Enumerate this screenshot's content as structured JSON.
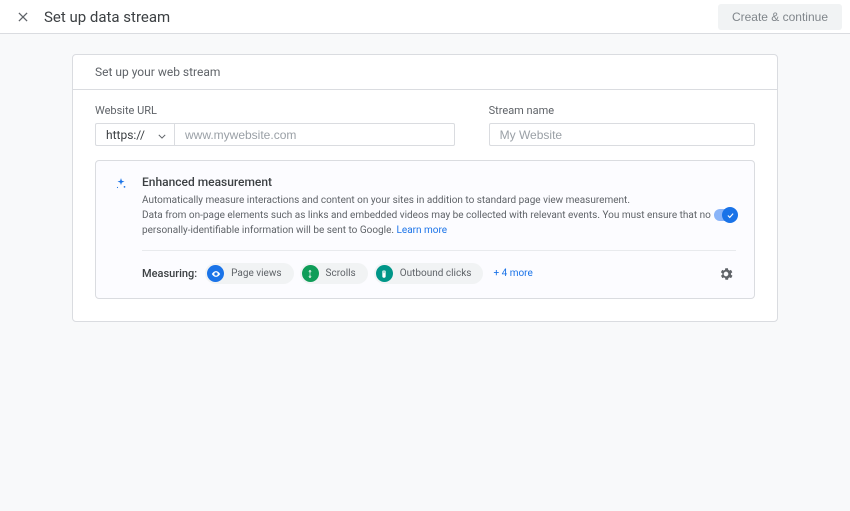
{
  "header": {
    "title": "Set up data stream",
    "create_label": "Create & continue"
  },
  "card": {
    "section_title": "Set up your web stream",
    "url_label": "Website URL",
    "protocol_selected": "https://",
    "url_placeholder": "www.mywebsite.com",
    "name_label": "Stream name",
    "name_placeholder": "My Website"
  },
  "enhanced": {
    "title": "Enhanced measurement",
    "desc1": "Automatically measure interactions and content on your sites in addition to standard page view measurement.",
    "desc2": "Data from on-page elements such as links and embedded videos may be collected with relevant events. You must ensure that no personally-identifiable information will be sent to Google. ",
    "learn_more": "Learn more",
    "measuring_label": "Measuring:",
    "chips": [
      {
        "label": "Page views"
      },
      {
        "label": "Scrolls"
      },
      {
        "label": "Outbound clicks"
      }
    ],
    "more": "+ 4 more"
  }
}
